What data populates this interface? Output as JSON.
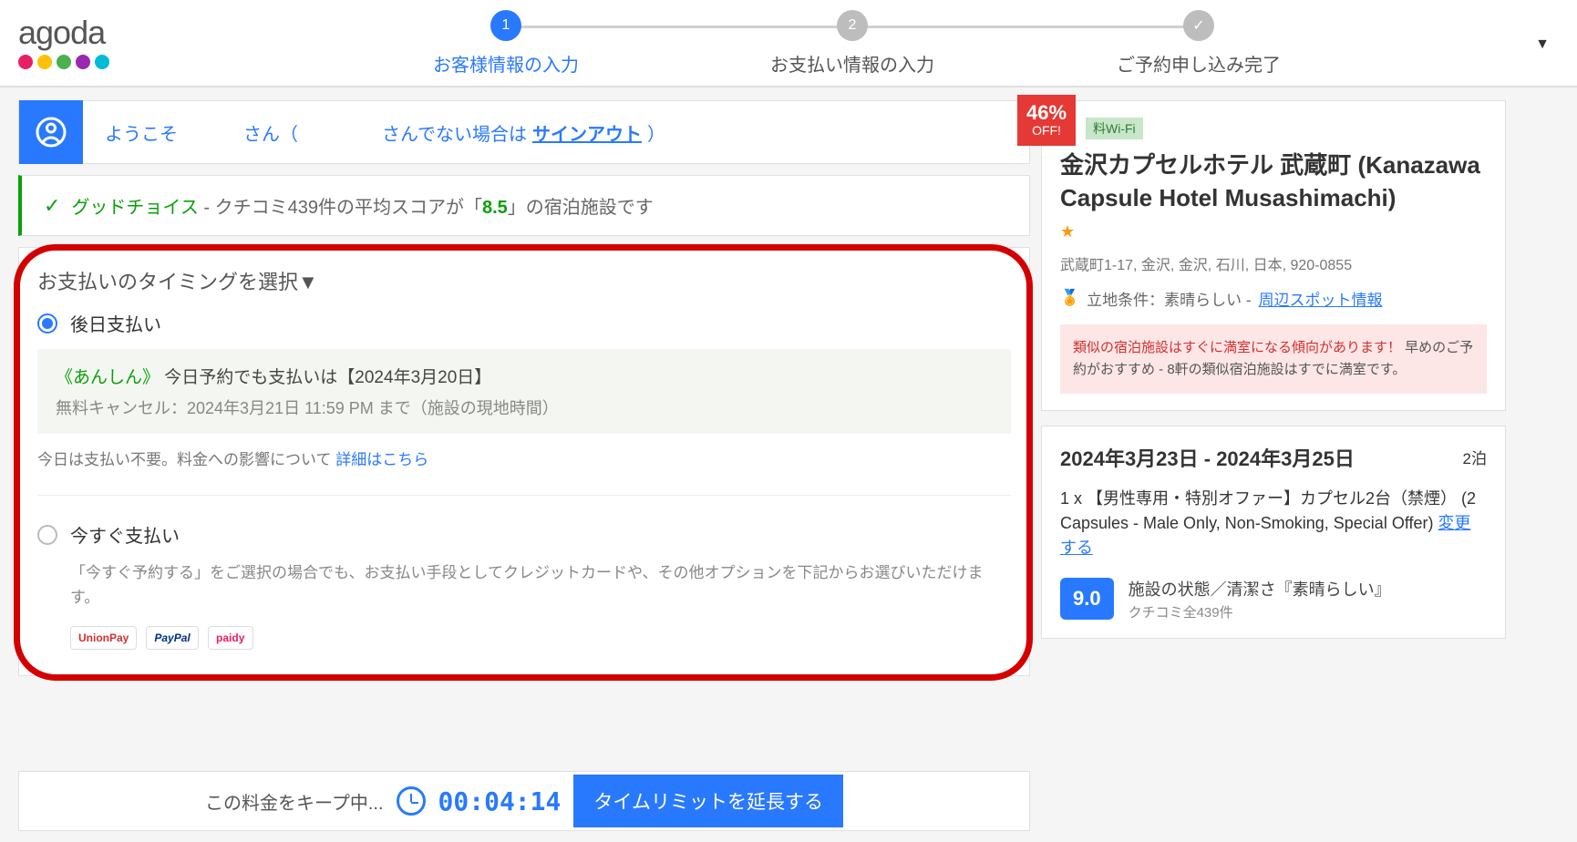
{
  "logo": "agoda",
  "steps": [
    {
      "num": "1",
      "label": "お客様情報の入力",
      "active": true
    },
    {
      "num": "2",
      "label": "お支払い情報の入力",
      "active": false
    },
    {
      "num": "✓",
      "label": "ご予約申し込み完了",
      "active": false
    }
  ],
  "welcome": {
    "greeting": "ようこそ",
    "san": "さん（",
    "notyou": "さんでない場合は ",
    "signout": "サインアウト",
    "close": "）"
  },
  "goodchoice": {
    "label": "グッドチョイス",
    "dash": " - ",
    "pre": "クチコミ439件の平均スコアが「",
    "score": "8.5",
    "post": "」の宿泊施設です"
  },
  "payment": {
    "title": "お支払いのタイミングを選択▼",
    "later_label": "後日支払い",
    "anshin": "《あんしん》",
    "later_line1": " 今日予約でも支払いは【2024年3月20日】",
    "later_line2": "無料キャンセル：2024年3月21日 11:59 PM まで（施設の現地時間）",
    "note_pre": "今日は支払い不要。料金への影響について ",
    "note_link": "詳細はこちら",
    "now_label": "今すぐ支払い",
    "now_desc": "「今すぐ予約する」をご選択の場合でも、お支払い手段としてクレジットカードや、その他オプションを下記からお選びいただけます。",
    "pm1": "UnionPay",
    "pm2": "PayPal",
    "pm3": "paidy"
  },
  "discount": {
    "pct": "46%",
    "off": "OFF!"
  },
  "hotel": {
    "wifi": "料Wi-Fi",
    "name": "金沢カプセルホテル 武蔵町 (Kanazawa Capsule Hotel Musashimachi)",
    "address": "武蔵町1-17, 金沢, 金沢, 石川, 日本, 920-0855",
    "loc_label": "立地条件：素晴らしい - ",
    "loc_link": "周辺スポット情報",
    "alert_red": "類似の宿泊施設はすぐに満室になる傾向があります！",
    "alert_rest": " 早めのご予約がおすすめ - 8軒の類似宿泊施設はすでに満室です。"
  },
  "booking": {
    "dates": "2024年3月23日 - 2024年3月25日",
    "nights": "2泊",
    "room_pre": "1 x 【男性専用・特別オファー】カプセル2台（禁煙） (2 Capsules - Male Only, Non-Smoking, Special Offer)",
    "change": "変更する",
    "score": "9.0",
    "review1": "施設の状態／清潔さ『素晴らしい』",
    "review2": "クチコミ全439件"
  },
  "bottom": {
    "keep": "この料金をキープ中...",
    "timer": "00:04:14",
    "extend": "タイムリミットを延長する"
  }
}
